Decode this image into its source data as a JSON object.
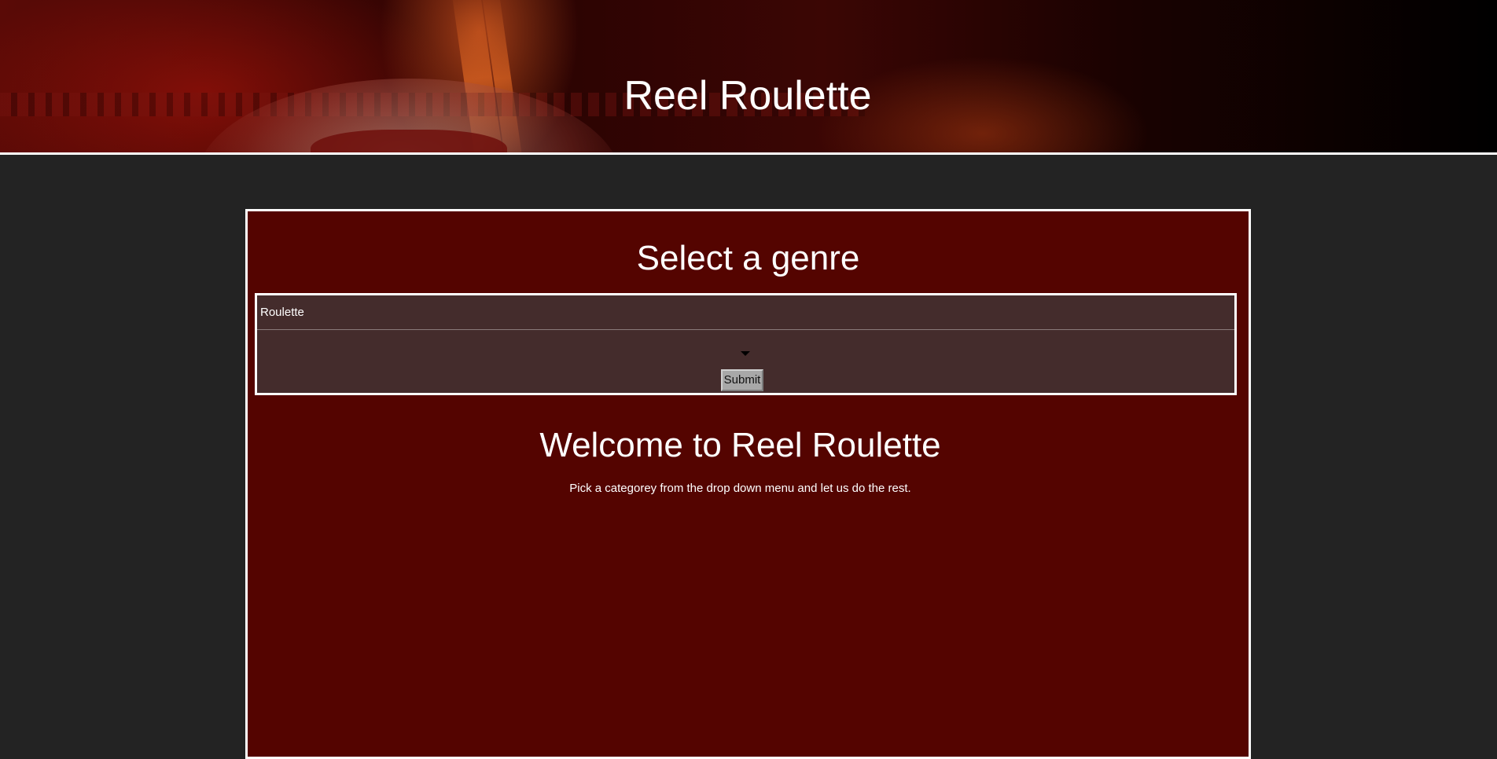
{
  "header": {
    "title": "Reel Roulette"
  },
  "genre_panel": {
    "heading": "Select a genre",
    "selected_option": "Roulette",
    "submit_label": "Submit"
  },
  "welcome": {
    "heading": "Welcome to Reel Roulette",
    "text": "Pick a categorey from the drop down menu and let us do the rest."
  },
  "colors": {
    "page_background": "#232323",
    "panel_background": "#540400",
    "form_background": "#442c2c",
    "border": "#ffffff"
  },
  "icons": {
    "dropdown": "chevron-down-icon"
  }
}
